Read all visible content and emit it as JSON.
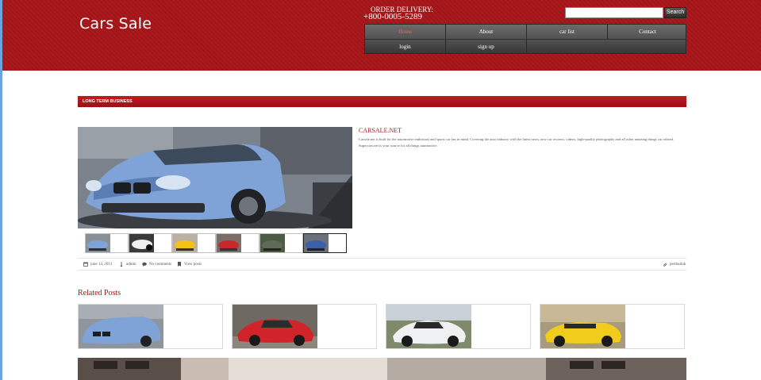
{
  "header": {
    "logo": "Cars Sale",
    "delivery_label": "ORDER DELIVERY:",
    "delivery_phone": "+800-0005-5289",
    "search_button": "Search",
    "search_value": "",
    "nav": [
      {
        "label": "Home",
        "active": true
      },
      {
        "label": "About",
        "active": false
      },
      {
        "label": "car list",
        "active": false
      },
      {
        "label": "Contact",
        "active": false
      },
      {
        "label": "login",
        "active": false
      },
      {
        "label": "sign up",
        "active": false
      }
    ]
  },
  "section": {
    "title": "LONG TERM BUSINESS"
  },
  "post": {
    "title": "CARSALE.NET",
    "body": "Carsale.net is built for the automotive enthusiast and sports car fan in mind. Covering the auto industry with the latest news, new car reviews, videos, high-quality photography and all other amazing things car related. Supercars.net is your source for all things automotive.",
    "thumbnails": [
      {
        "name": "blue-bmw"
      },
      {
        "name": "white-car"
      },
      {
        "name": "yellow-car"
      },
      {
        "name": "red-car"
      },
      {
        "name": "green-car"
      },
      {
        "name": "blue-car",
        "selected": true
      }
    ]
  },
  "meta": {
    "date": "june 14, 2013",
    "author": "admin",
    "comments": "No comments",
    "view": "View posts",
    "permalink": "permalink"
  },
  "related": {
    "title": "Related Posts",
    "cards": [
      {
        "name": "blue-bmw"
      },
      {
        "name": "red-ferrari"
      },
      {
        "name": "white-corvette"
      },
      {
        "name": "yellow-mustang"
      }
    ]
  },
  "colors": {
    "brand_red": "#a8161a",
    "nav_dark": "#383838"
  }
}
